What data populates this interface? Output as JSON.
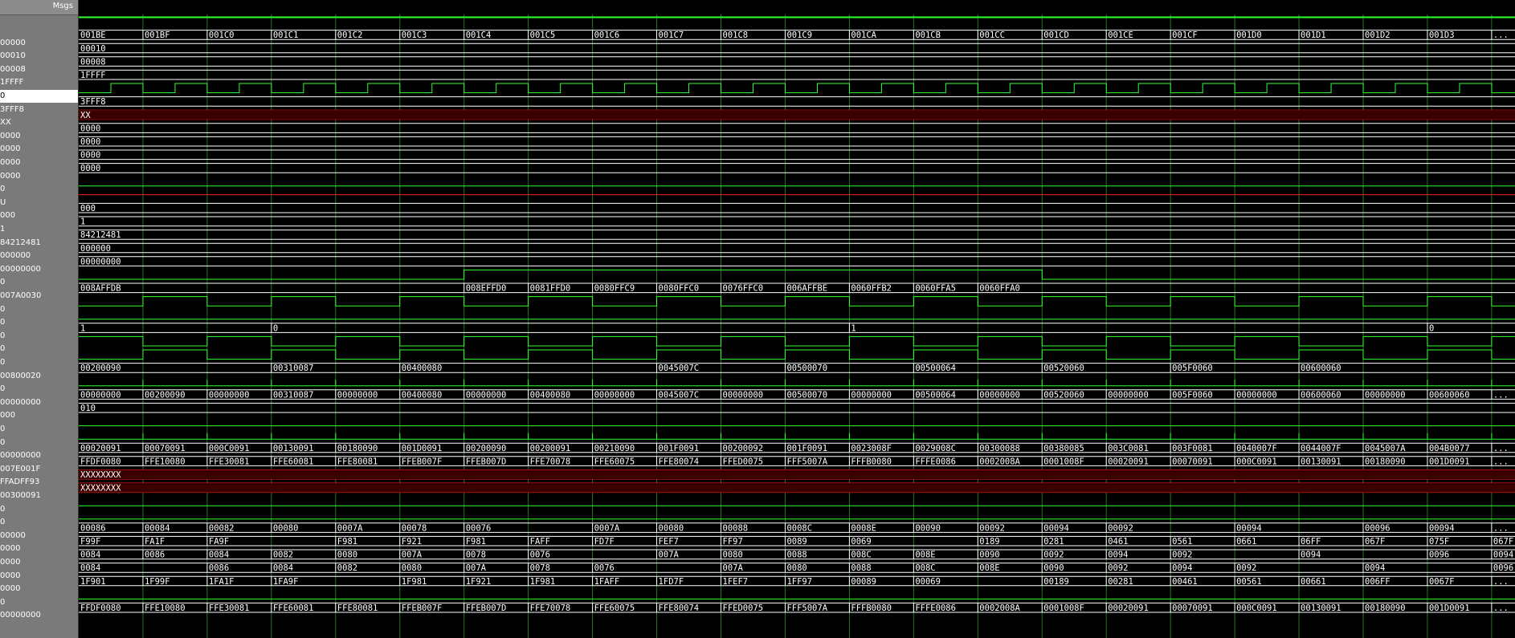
{
  "header": {
    "msgs_label": "Msgs"
  },
  "colors": {
    "wave": "#33ff33",
    "bus": "#ffffff",
    "unknown": "#ff2020",
    "grid": "#2f6f2f",
    "clock": "#33ff33"
  },
  "signals": [
    {
      "value": "",
      "type": "high",
      "selected": false
    },
    {
      "value": "00000",
      "type": "bus",
      "segs": [
        [
          0,
          "001BE"
        ],
        [
          1,
          "001BF"
        ],
        [
          2,
          "001C0"
        ],
        [
          3,
          "001C1"
        ],
        [
          4,
          "001C2"
        ],
        [
          5,
          "001C3"
        ],
        [
          6,
          "001C4"
        ],
        [
          7,
          "001C5"
        ],
        [
          8,
          "001C6"
        ],
        [
          9,
          "001C7"
        ],
        [
          10,
          "001C8"
        ],
        [
          11,
          "001C9"
        ],
        [
          12,
          "001CA"
        ],
        [
          13,
          "001CB"
        ],
        [
          14,
          "001CC"
        ],
        [
          15,
          "001CD"
        ],
        [
          16,
          "001CE"
        ],
        [
          17,
          "001CF"
        ],
        [
          18,
          "001D0"
        ],
        [
          19,
          "001D1"
        ],
        [
          20,
          "001D2"
        ],
        [
          21,
          "001D3"
        ],
        [
          22,
          "..."
        ]
      ]
    },
    {
      "value": "00010",
      "type": "bus",
      "segs": [
        [
          0,
          "00010"
        ]
      ]
    },
    {
      "value": "00008",
      "type": "bus",
      "segs": [
        [
          0,
          "00008"
        ]
      ]
    },
    {
      "value": "1FFFF",
      "type": "bus",
      "segs": [
        [
          0,
          "1FFFF"
        ]
      ]
    },
    {
      "value": "0",
      "type": "clock",
      "selected": true
    },
    {
      "value": "3FFF8",
      "type": "bus",
      "segs": [
        [
          0,
          "3FFF8"
        ]
      ]
    },
    {
      "value": "XX",
      "type": "xbus",
      "segs": [
        [
          0,
          "XX"
        ]
      ]
    },
    {
      "value": "0000",
      "type": "bus",
      "segs": [
        [
          0,
          "0000"
        ]
      ]
    },
    {
      "value": "0000",
      "type": "bus",
      "segs": [
        [
          0,
          "0000"
        ]
      ]
    },
    {
      "value": "0000",
      "type": "bus",
      "segs": [
        [
          0,
          "0000"
        ]
      ]
    },
    {
      "value": "0000",
      "type": "bus",
      "segs": [
        [
          0,
          "0000"
        ]
      ]
    },
    {
      "value": "0",
      "type": "low"
    },
    {
      "value": "U",
      "type": "x"
    },
    {
      "value": "000",
      "type": "bus",
      "segs": [
        [
          0,
          "000"
        ]
      ]
    },
    {
      "value": "1",
      "type": "bus",
      "segs": [
        [
          0,
          "1"
        ]
      ]
    },
    {
      "value": "84212481",
      "type": "bus",
      "segs": [
        [
          0,
          "84212481"
        ]
      ]
    },
    {
      "value": "000000",
      "type": "bus",
      "segs": [
        [
          0,
          "000000"
        ]
      ]
    },
    {
      "value": "00000000",
      "type": "bus",
      "segs": [
        [
          0,
          "00000000"
        ]
      ]
    },
    {
      "value": "0",
      "type": "pulse",
      "from": 6,
      "to": 15
    },
    {
      "value": "007A0030",
      "type": "bus",
      "segs": [
        [
          0,
          "008AFFDB"
        ],
        [
          6,
          "008EFFD0"
        ],
        [
          7,
          "0081FFD0"
        ],
        [
          8,
          "0080FFC9"
        ],
        [
          9,
          "0080FFC0"
        ],
        [
          10,
          "0076FFC0"
        ],
        [
          11,
          "006AFFBE"
        ],
        [
          12,
          "0060FFB2"
        ],
        [
          13,
          "0060FFA5"
        ],
        [
          14,
          "0060FFA0"
        ]
      ]
    },
    {
      "value": "0",
      "type": "clock2"
    },
    {
      "value": "0",
      "type": "low"
    },
    {
      "value": "0",
      "type": "bus",
      "segs": [
        [
          0,
          "1"
        ],
        [
          3,
          "0"
        ],
        [
          12,
          "1"
        ],
        [
          21,
          "0"
        ]
      ]
    },
    {
      "value": "0",
      "type": "clock2b"
    },
    {
      "value": "0",
      "type": "clock2"
    },
    {
      "value": "00800020",
      "type": "bus",
      "segs": [
        [
          0,
          "00200090"
        ],
        [
          3,
          "00310087"
        ],
        [
          5,
          "00400080"
        ],
        [
          9,
          "0045007C"
        ],
        [
          11,
          "00500070"
        ],
        [
          13,
          "00500064"
        ],
        [
          15,
          "00520060"
        ],
        [
          17,
          "005F0060"
        ],
        [
          19,
          "00600060"
        ]
      ]
    },
    {
      "value": "0",
      "type": "ticks"
    },
    {
      "value": "00000000",
      "type": "bus",
      "segs": [
        [
          0,
          "00000000"
        ],
        [
          1,
          "00200090"
        ],
        [
          2,
          "00000000"
        ],
        [
          3,
          "00310087"
        ],
        [
          4,
          "00000000"
        ],
        [
          5,
          "00400080"
        ],
        [
          6,
          "00000000"
        ],
        [
          7,
          "00400080"
        ],
        [
          8,
          "00000000"
        ],
        [
          9,
          "0045007C"
        ],
        [
          10,
          "00000000"
        ],
        [
          11,
          "00500070"
        ],
        [
          12,
          "00000000"
        ],
        [
          13,
          "00500064"
        ],
        [
          14,
          "00000000"
        ],
        [
          15,
          "00520060"
        ],
        [
          16,
          "00000000"
        ],
        [
          17,
          "005F0060"
        ],
        [
          18,
          "00000000"
        ],
        [
          19,
          "00600060"
        ],
        [
          20,
          "00000000"
        ],
        [
          21,
          "00600060"
        ],
        [
          22,
          "..."
        ]
      ]
    },
    {
      "value": "000",
      "type": "bus",
      "segs": [
        [
          0,
          "010"
        ]
      ]
    },
    {
      "value": "0",
      "type": "low"
    },
    {
      "value": "0",
      "type": "ticks"
    },
    {
      "value": "00000000",
      "type": "bus",
      "segs": [
        [
          0,
          "00020091"
        ],
        [
          1,
          "00070091"
        ],
        [
          2,
          "000C0091"
        ],
        [
          3,
          "00130091"
        ],
        [
          4,
          "00180090"
        ],
        [
          5,
          "001D0091"
        ],
        [
          6,
          "00200090"
        ],
        [
          7,
          "00200091"
        ],
        [
          8,
          "00210090"
        ],
        [
          9,
          "001F0091"
        ],
        [
          10,
          "00200092"
        ],
        [
          11,
          "001F0091"
        ],
        [
          12,
          "0023008F"
        ],
        [
          13,
          "0029008C"
        ],
        [
          14,
          "00300088"
        ],
        [
          15,
          "00380085"
        ],
        [
          16,
          "003C0081"
        ],
        [
          17,
          "003F0081"
        ],
        [
          18,
          "0040007F"
        ],
        [
          19,
          "0044007F"
        ],
        [
          20,
          "0045007A"
        ],
        [
          21,
          "004B0077"
        ],
        [
          22,
          "..."
        ]
      ]
    },
    {
      "value": "007E001F",
      "type": "bus",
      "segs": [
        [
          0,
          "FFDF0080"
        ],
        [
          1,
          "FFE10080"
        ],
        [
          2,
          "FFE30081"
        ],
        [
          3,
          "FFE60081"
        ],
        [
          4,
          "FFE80081"
        ],
        [
          5,
          "FFEB007F"
        ],
        [
          6,
          "FFEB007D"
        ],
        [
          7,
          "FFE70078"
        ],
        [
          8,
          "FFE60075"
        ],
        [
          9,
          "FFE80074"
        ],
        [
          10,
          "FFED0075"
        ],
        [
          11,
          "FFF5007A"
        ],
        [
          12,
          "FFFB0080"
        ],
        [
          13,
          "FFFE0086"
        ],
        [
          14,
          "0002008A"
        ],
        [
          15,
          "0001008F"
        ],
        [
          16,
          "00020091"
        ],
        [
          17,
          "00070091"
        ],
        [
          18,
          "000C0091"
        ],
        [
          19,
          "00130091"
        ],
        [
          20,
          "00180090"
        ],
        [
          21,
          "001D0091"
        ],
        [
          22,
          "..."
        ]
      ]
    },
    {
      "value": "FFADFF93",
      "type": "xbus",
      "segs": [
        [
          0,
          "XXXXXXXX"
        ]
      ]
    },
    {
      "value": "00300091",
      "type": "xbus",
      "segs": [
        [
          0,
          "XXXXXXXX"
        ]
      ]
    },
    {
      "value": "0",
      "type": "low"
    },
    {
      "value": "0",
      "type": "low"
    },
    {
      "value": "00000",
      "type": "bus",
      "segs": [
        [
          0,
          "00086"
        ],
        [
          1,
          "00084"
        ],
        [
          2,
          "00082"
        ],
        [
          3,
          "00080"
        ],
        [
          4,
          "0007A"
        ],
        [
          5,
          "00078"
        ],
        [
          6,
          "00076"
        ],
        [
          8,
          "0007A"
        ],
        [
          9,
          "00080"
        ],
        [
          10,
          "00088"
        ],
        [
          11,
          "0008C"
        ],
        [
          12,
          "0008E"
        ],
        [
          13,
          "00090"
        ],
        [
          14,
          "00092"
        ],
        [
          15,
          "00094"
        ],
        [
          16,
          "00092"
        ],
        [
          18,
          "00094"
        ],
        [
          20,
          "00096"
        ],
        [
          21,
          "00094"
        ],
        [
          22,
          "..."
        ]
      ]
    },
    {
      "value": "0000",
      "type": "bus",
      "segs": [
        [
          0,
          "F99F"
        ],
        [
          1,
          "FA1F"
        ],
        [
          2,
          "FA9F"
        ],
        [
          4,
          "F981"
        ],
        [
          5,
          "F921"
        ],
        [
          6,
          "F981"
        ],
        [
          7,
          "FAFF"
        ],
        [
          8,
          "FD7F"
        ],
        [
          9,
          "FEF7"
        ],
        [
          10,
          "FF97"
        ],
        [
          11,
          "0089"
        ],
        [
          12,
          "0069"
        ],
        [
          14,
          "0189"
        ],
        [
          15,
          "0281"
        ],
        [
          16,
          "0461"
        ],
        [
          17,
          "0561"
        ],
        [
          18,
          "0661"
        ],
        [
          19,
          "06FF"
        ],
        [
          20,
          "067F"
        ],
        [
          21,
          "075F"
        ],
        [
          22,
          "067F"
        ]
      ]
    },
    {
      "value": "0000",
      "type": "bus",
      "segs": [
        [
          0,
          "0084"
        ],
        [
          1,
          "0086"
        ],
        [
          2,
          "0084"
        ],
        [
          3,
          "0082"
        ],
        [
          4,
          "0080"
        ],
        [
          5,
          "007A"
        ],
        [
          6,
          "0078"
        ],
        [
          7,
          "0076"
        ],
        [
          9,
          "007A"
        ],
        [
          10,
          "0080"
        ],
        [
          11,
          "0088"
        ],
        [
          12,
          "008C"
        ],
        [
          13,
          "008E"
        ],
        [
          14,
          "0090"
        ],
        [
          15,
          "0092"
        ],
        [
          16,
          "0094"
        ],
        [
          17,
          "0092"
        ],
        [
          19,
          "0094"
        ],
        [
          21,
          "0096"
        ],
        [
          22,
          "0094"
        ]
      ]
    },
    {
      "value": "0000",
      "type": "bus",
      "segs": [
        [
          0,
          "0084"
        ],
        [
          2,
          "0086"
        ],
        [
          3,
          "0084"
        ],
        [
          4,
          "0082"
        ],
        [
          5,
          "0080"
        ],
        [
          6,
          "007A"
        ],
        [
          7,
          "0078"
        ],
        [
          8,
          "0076"
        ],
        [
          10,
          "007A"
        ],
        [
          11,
          "0080"
        ],
        [
          12,
          "0088"
        ],
        [
          13,
          "008C"
        ],
        [
          14,
          "008E"
        ],
        [
          15,
          "0090"
        ],
        [
          16,
          "0092"
        ],
        [
          17,
          "0094"
        ],
        [
          18,
          "0092"
        ],
        [
          20,
          "0094"
        ],
        [
          22,
          "0096"
        ]
      ]
    },
    {
      "value": "0000",
      "type": "bus",
      "segs": [
        [
          0,
          "1F901"
        ],
        [
          1,
          "1F99F"
        ],
        [
          2,
          "1FA1F"
        ],
        [
          3,
          "1FA9F"
        ],
        [
          5,
          "1F981"
        ],
        [
          6,
          "1F921"
        ],
        [
          7,
          "1F981"
        ],
        [
          8,
          "1FAFF"
        ],
        [
          9,
          "1FD7F"
        ],
        [
          10,
          "1FEF7"
        ],
        [
          11,
          "1FF97"
        ],
        [
          12,
          "00089"
        ],
        [
          13,
          "00069"
        ],
        [
          15,
          "00189"
        ],
        [
          16,
          "00281"
        ],
        [
          17,
          "00461"
        ],
        [
          18,
          "00561"
        ],
        [
          19,
          "00661"
        ],
        [
          20,
          "006FF"
        ],
        [
          21,
          "0067F"
        ],
        [
          22,
          "..."
        ]
      ]
    },
    {
      "value": "0",
      "type": "low"
    },
    {
      "value": "00000000",
      "type": "bus",
      "segs": [
        [
          0,
          "FFDF0080"
        ],
        [
          1,
          "FFE10080"
        ],
        [
          2,
          "FFE30081"
        ],
        [
          3,
          "FFE60081"
        ],
        [
          4,
          "FFE80081"
        ],
        [
          5,
          "FFEB007F"
        ],
        [
          6,
          "FFEB007D"
        ],
        [
          7,
          "FFE70078"
        ],
        [
          8,
          "FFE60075"
        ],
        [
          9,
          "FFE80074"
        ],
        [
          10,
          "FFED0075"
        ],
        [
          11,
          "FFF5007A"
        ],
        [
          12,
          "FFFB0080"
        ],
        [
          13,
          "FFFE0086"
        ],
        [
          14,
          "0002008A"
        ],
        [
          15,
          "0001008F"
        ],
        [
          16,
          "00020091"
        ],
        [
          17,
          "00070091"
        ],
        [
          18,
          "000C0091"
        ],
        [
          19,
          "00130091"
        ],
        [
          20,
          "00180090"
        ],
        [
          21,
          "001D0091"
        ],
        [
          22,
          "..."
        ]
      ]
    }
  ]
}
